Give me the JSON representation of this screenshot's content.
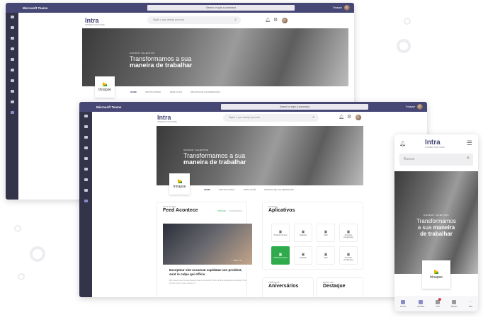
{
  "teams": {
    "app_name": "Microsoft Teams",
    "command_placeholder": "Search or type a command",
    "user": "Trinapse"
  },
  "rail": [
    "Activity",
    "Chat",
    "Teams",
    "Calendar",
    "Calls",
    "Files",
    "Todo",
    "Planner",
    "Help",
    "Intranet"
  ],
  "intranet": {
    "logo": "Intra",
    "logo_tag": "INTRANET FOR TEAMS",
    "search_placeholder": "Digite o que deseja procurar",
    "hero": {
      "eyebrow": "UNINDO TALENTOS",
      "line1": "Transformamos a sua",
      "line2": "maneira de trabalhar"
    },
    "brand": "trinapse",
    "tabs": [
      "HOME",
      "INSTITUCIONAL",
      "PARA VOCÊ",
      "GRUPOS DE COLABORAÇÃO"
    ]
  },
  "feed": {
    "eyebrow": "VEJA NOSSO",
    "title": "Feed Acontece",
    "filters": [
      "NOTÍCIAS",
      "COMUNICADOS"
    ],
    "likes": "194",
    "comments": "2",
    "post_title": "Excepteur sint occaecat cupidatat non proident, sunt in culpa qui officia",
    "post_excerpt": "We have loved to see design teams transform from a few designers working in the corner of the open space [...]"
  },
  "apps": {
    "eyebrow": "NOSSOS",
    "title": "Aplicativos",
    "items": [
      "Políticas Internas",
      "Relatório",
      "SED",
      "Reuniões Designadas",
      "Políticas Internas",
      "Relatório",
      "SED",
      "Reuniões Designadas"
    ],
    "active_index": 4,
    "accent": "#2fab4c"
  },
  "birthdays": {
    "eyebrow": "PRÓXIMOS",
    "title": "Aniversários"
  },
  "dates": {
    "eyebrow": "DATAS EM",
    "title": "Destaque"
  },
  "mobile": {
    "search_placeholder": "Buscar",
    "hero_eyebrow": "UNINDO TALENTOS",
    "hero_l1": "Transformamos",
    "hero_l2a": "a sua",
    "hero_l2b": "maneira",
    "hero_l3": "de trabalhar",
    "nav": [
      "Intranet",
      "Atividade",
      "Chat",
      "Equipes",
      "Mais"
    ],
    "chat_badge": "2"
  },
  "colors": {
    "teams_purple": "#464775",
    "rail": "#33344a"
  }
}
